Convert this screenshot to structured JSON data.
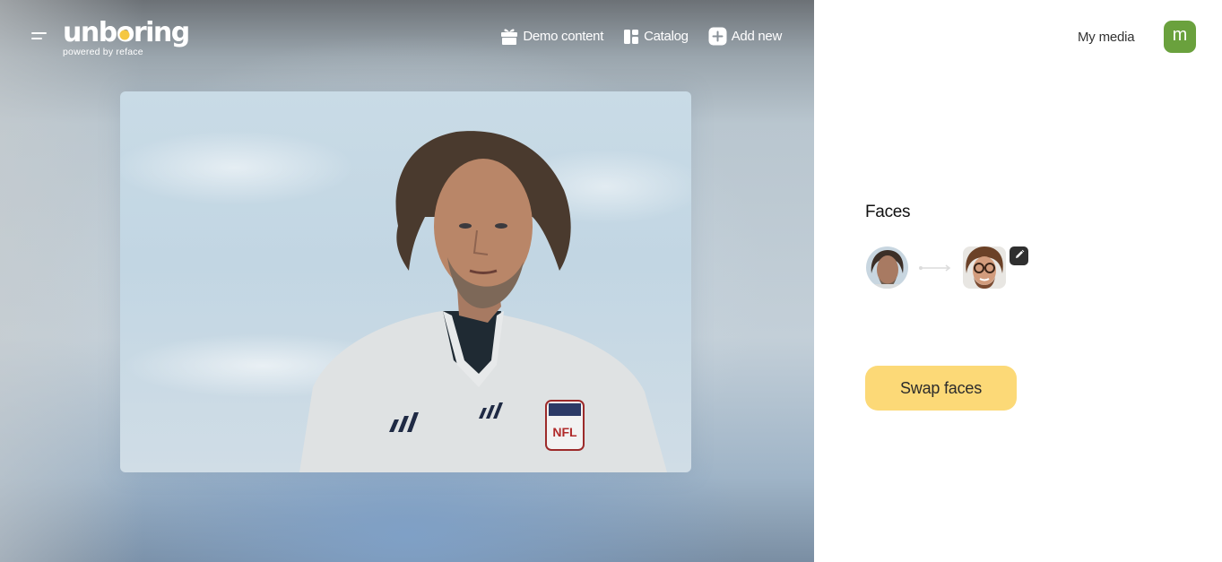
{
  "app": {
    "logo_text_before": "unb",
    "logo_text_o": "o",
    "logo_text_after": "ring",
    "logo_subtitle": "powered by reface",
    "brand_accent": "#f5c742"
  },
  "nav": {
    "items": [
      {
        "label": "Demo content",
        "icon": "gift-icon"
      },
      {
        "label": "Catalog",
        "icon": "catalog-grid-icon"
      },
      {
        "label": "Add new",
        "icon": "plus-square-icon"
      }
    ]
  },
  "account": {
    "my_media_label": "My media",
    "avatar_initial": "m",
    "avatar_color": "#6aa13d"
  },
  "media": {
    "description": "Photo of a man with curly hair wearing a white football jersey against a cloudy sky"
  },
  "faces": {
    "title": "Faces",
    "source_face": "source-face-thumbnail",
    "target_face": "target-face-thumbnail-with-glasses",
    "edit_icon": "pencil-icon"
  },
  "actions": {
    "swap_label": "Swap faces",
    "swap_color": "#fcd977"
  }
}
